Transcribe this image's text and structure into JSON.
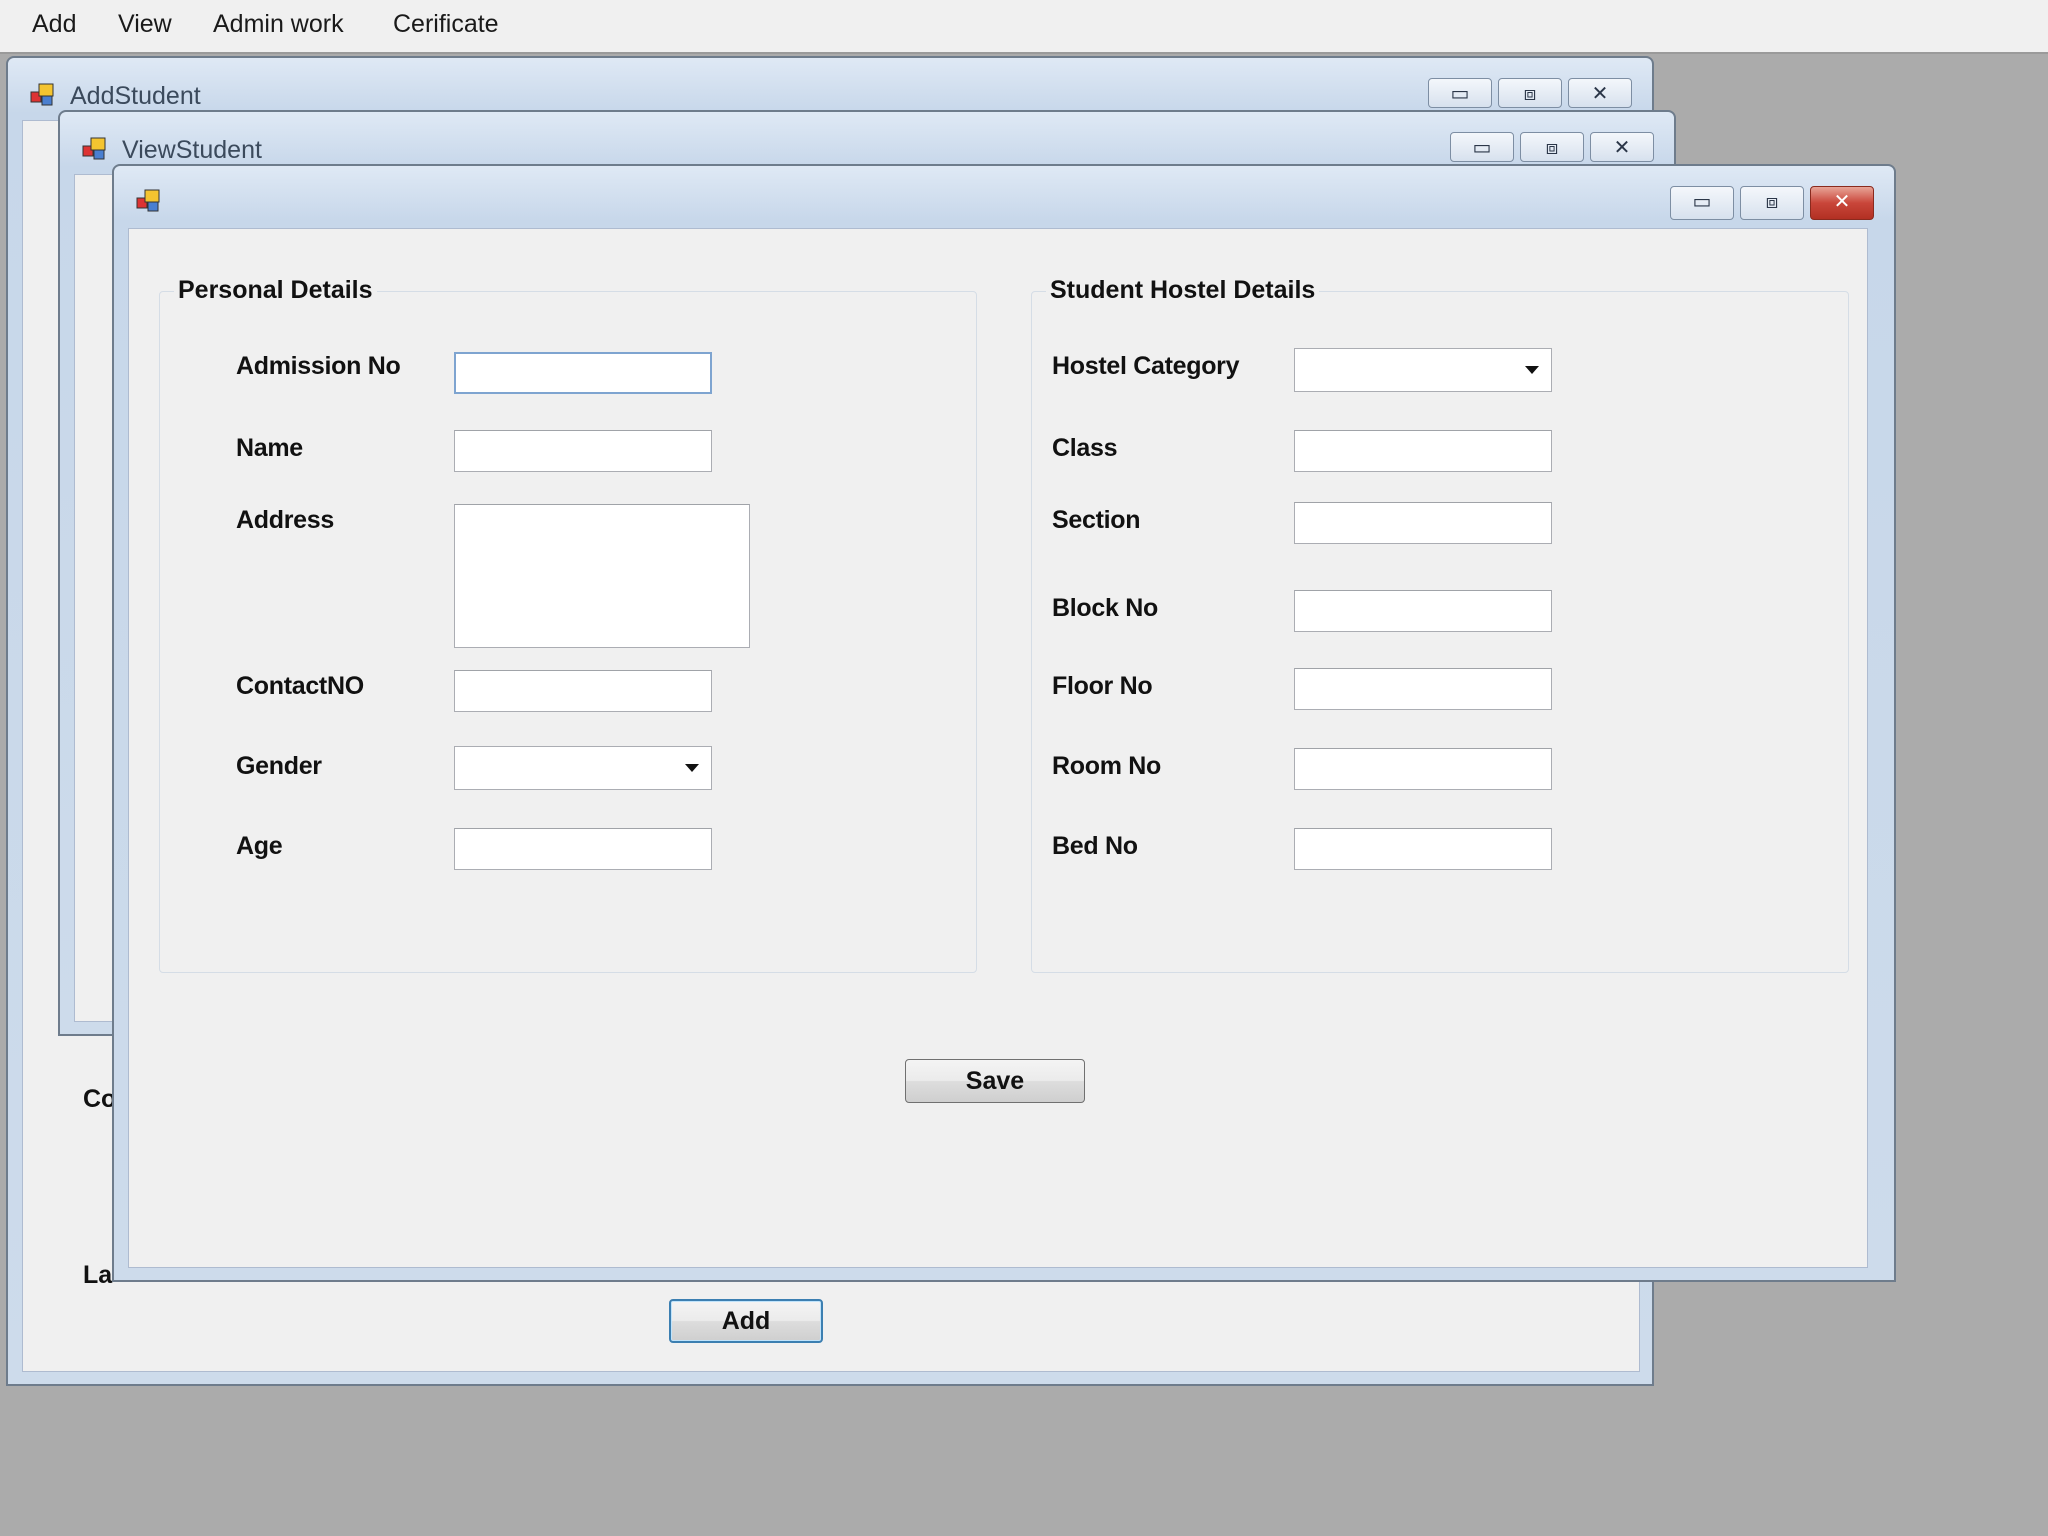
{
  "menubar": {
    "items": [
      "Add",
      "View",
      "Admin work",
      "Cerificate"
    ]
  },
  "windows": {
    "add_student": {
      "title": "AddStudent",
      "add_button": "Add",
      "partial_labels": [
        "Co",
        "La"
      ]
    },
    "view_student": {
      "title": "ViewStudent"
    },
    "form": {
      "title": "",
      "personal": {
        "group_title": "Personal Details",
        "admission_no_label": "Admission No",
        "name_label": "Name",
        "address_label": "Address",
        "contact_label": "ContactNO",
        "gender_label": "Gender",
        "age_label": "Age",
        "admission_no_value": "",
        "name_value": "",
        "address_value": "",
        "contact_value": "",
        "gender_value": "",
        "age_value": ""
      },
      "hostel": {
        "group_title": "Student Hostel Details",
        "category_label": "Hostel Category",
        "class_label": "Class",
        "section_label": "Section",
        "block_label": "Block No",
        "floor_label": "Floor No",
        "room_label": "Room No",
        "bed_label": "Bed No",
        "category_value": "",
        "class_value": "",
        "section_value": "",
        "block_value": "",
        "floor_value": "",
        "room_value": "",
        "bed_value": ""
      },
      "save_button": "Save"
    }
  },
  "caption_buttons": {
    "minimize": "▭",
    "maximize": "⧈",
    "close": "✕"
  },
  "colors": {
    "mdi_background": "#ababab",
    "close_button": "#c9463a",
    "window_frame": "#c7d7ea"
  }
}
